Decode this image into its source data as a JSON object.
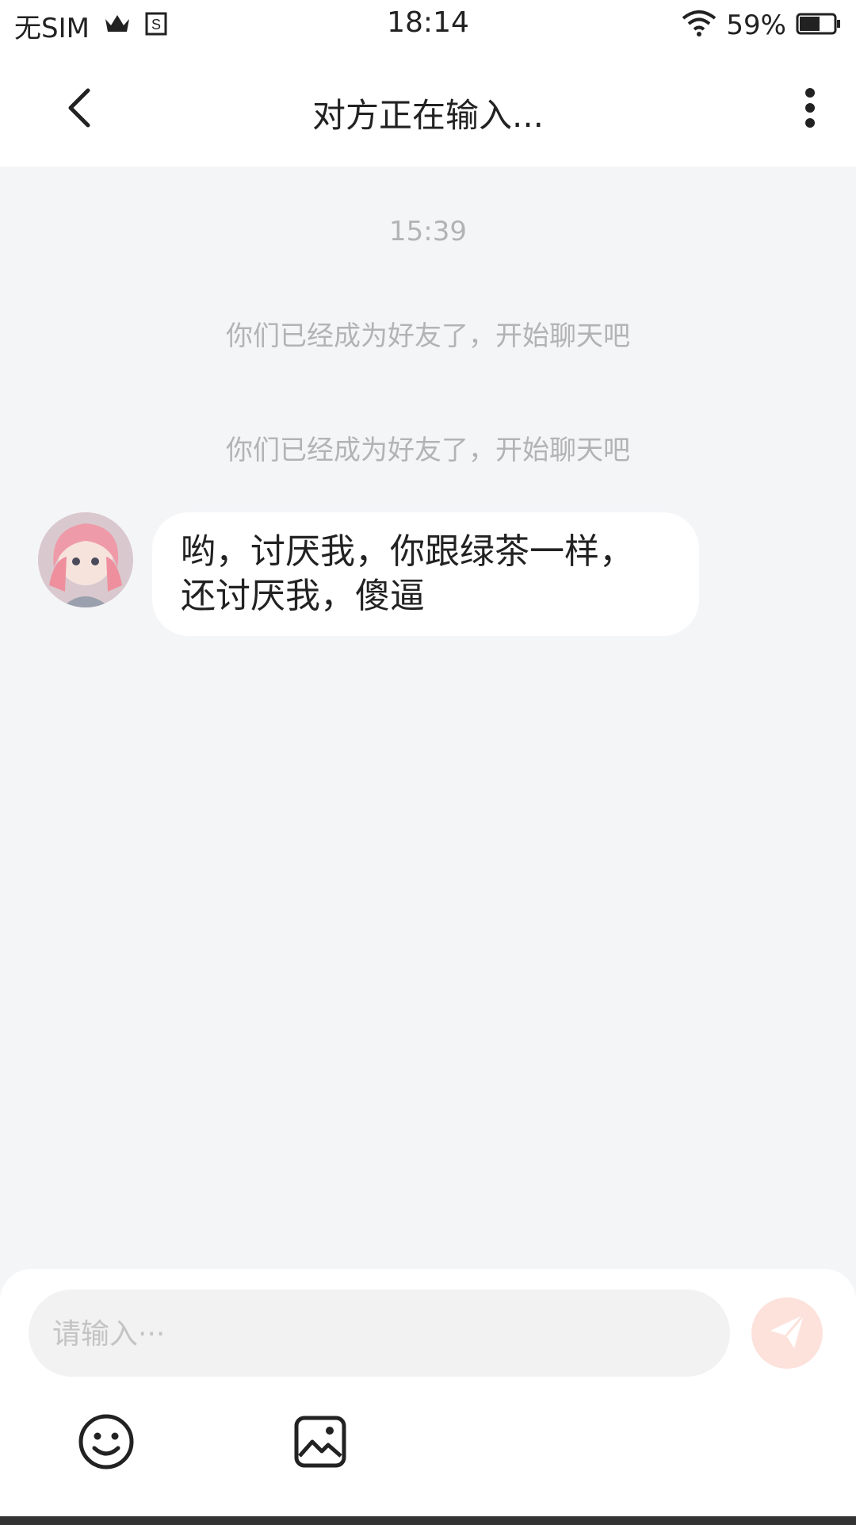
{
  "status_bar": {
    "carrier": "无SIM",
    "time": "18:14",
    "battery": "59%",
    "battery_level": 0.59,
    "icons": [
      "crown-icon",
      "s-app-icon",
      "wifi-icon",
      "battery-icon"
    ]
  },
  "nav": {
    "title": "对方正在输入...",
    "icons": [
      "chevron-left-icon",
      "more-vertical-icon"
    ]
  },
  "chat": {
    "timestamp": "15:39",
    "system_messages": [
      "你们已经成为好友了，开始聊天吧",
      "你们已经成为好友了，开始聊天吧"
    ],
    "messages": [
      {
        "from": "other",
        "text": "哟，讨厌我，你跟绿茶一样，还讨厌我，傻逼"
      }
    ]
  },
  "composer": {
    "placeholder": "请输入···",
    "value": "",
    "icons": [
      "send-icon",
      "emoji-icon",
      "image-icon"
    ]
  },
  "colors": {
    "page_bg": "#f4f5f7",
    "bubble_bg": "#ffffff",
    "send_accent": "#fde2dc",
    "muted_text": "#b3b3b3"
  }
}
